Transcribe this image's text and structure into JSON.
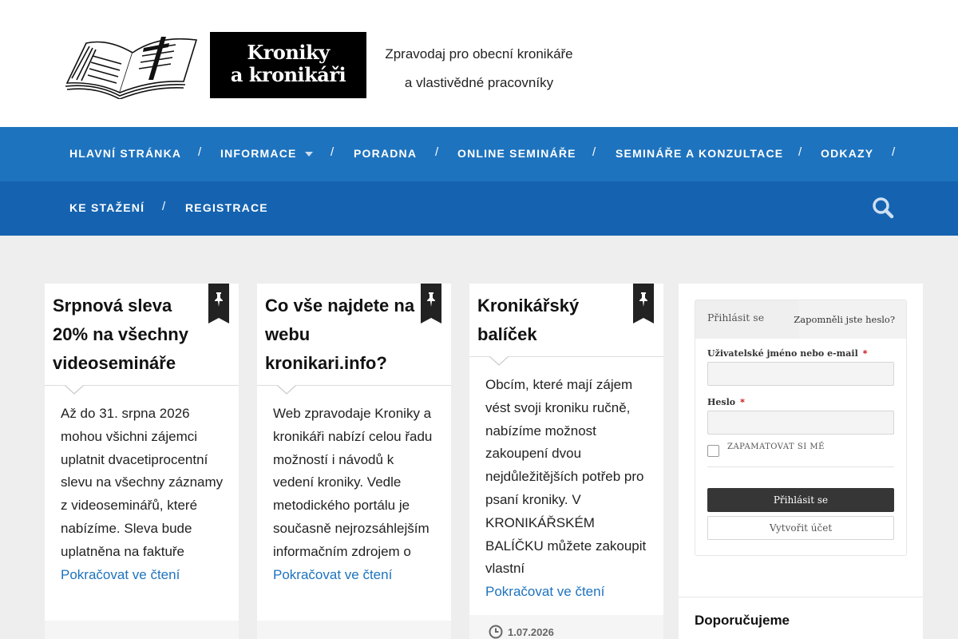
{
  "header": {
    "logo_text_line1": "Kroniky",
    "logo_text_line2": "a kronikáři",
    "tagline_line1": "Zpravodaj pro obecní kronikáře",
    "tagline_line2": "a vlastivědné pracovníky"
  },
  "nav": {
    "row1": [
      {
        "label": "HLAVNÍ STRÁNKA"
      },
      {
        "label": "INFORMACE",
        "has_submenu": true
      },
      {
        "label": "PORADNA"
      },
      {
        "label": "ONLINE SEMINÁŘE"
      },
      {
        "label": "SEMINÁŘE A KONZULTACE"
      },
      {
        "label": "ODKAZY"
      }
    ],
    "row2": [
      {
        "label": "KE STAŽENÍ"
      },
      {
        "label": "REGISTRACE"
      }
    ],
    "separator": "/",
    "search_icon": "search-icon"
  },
  "posts": [
    {
      "title": "Srpnová sleva 20% na všechny videosemináře",
      "excerpt": "Až do 31. srpna 2026 mohou všichni zájemci uplatnit dvacetiprocentní slevu na všechny záznamy z videoseminářů, které nabízíme. Sleva bude uplatněna na faktuře",
      "read_more": "Pokračovat ve čtení",
      "sticky_icon": "pin-icon"
    },
    {
      "title": "Co vše najdete na webu kronikari.info?",
      "excerpt": "Web zpravodaje Kroniky a kronikáři nabízí celou řadu možností i návodů k vedení kroniky. Vedle metodického portálu je současně nejrozsáhlejším informačním zdrojem o",
      "read_more": "Pokračovat ve čtení",
      "sticky_icon": "pin-icon"
    },
    {
      "title": "Kronikářský balíček",
      "excerpt": "Obcím, které mají zájem vést svoji kroniku ručně, nabízíme možnost zakoupení dvou nejdůležitějších potřeb pro psaní kroniky. V KRONIKÁŘSKÉM BALÍČKU můžete zakoupit vlastní",
      "read_more": "Pokračovat ve čtení",
      "sticky_icon": "pin-icon",
      "date": "1.07.2026"
    }
  ],
  "sidebar": {
    "login": {
      "tab_login": "Přihlásit se",
      "forgot_password": "Zapomněli jste heslo?",
      "username_label": "Uživatelské jméno nebo e-mail",
      "password_label": "Heslo",
      "required_mark": "*",
      "remember_label": "ZAPAMATOVAT SI MĚ",
      "submit_label": "Přihlásit se",
      "register_label": "Vytvořit účet",
      "username_value": "",
      "password_value": ""
    },
    "widget_title": "Doporučujeme"
  },
  "colors": {
    "nav_primary": "#1e73be",
    "nav_secondary": "#1563b0",
    "link": "#1e73be",
    "page_bg": "#eeeeee"
  }
}
